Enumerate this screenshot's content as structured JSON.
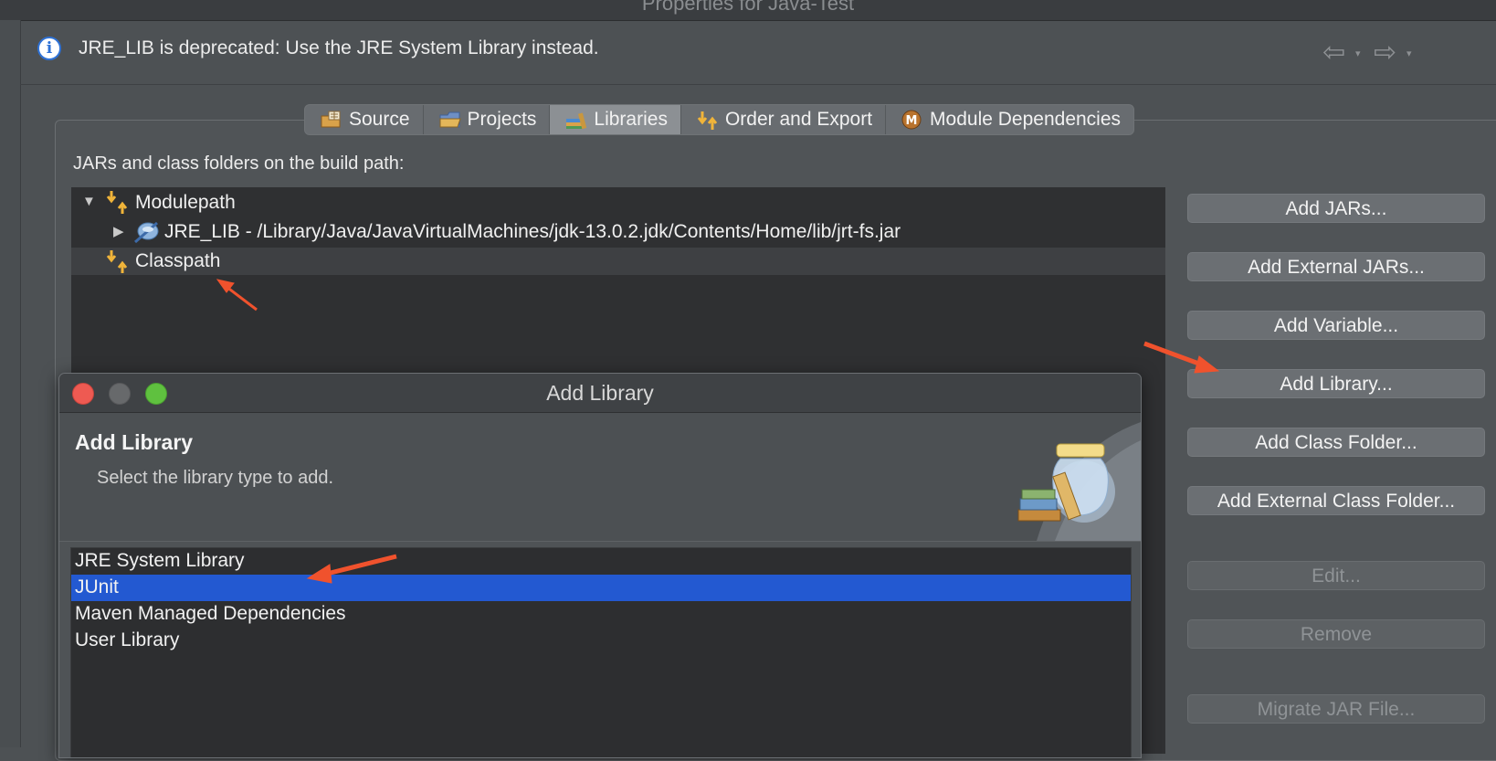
{
  "window": {
    "title": "Properties for Java-Test"
  },
  "info_bar": {
    "message": "JRE_LIB is deprecated: Use the JRE System Library instead."
  },
  "tabs": [
    {
      "label": "Source",
      "icon": "source-folder-icon",
      "active": false
    },
    {
      "label": "Projects",
      "icon": "projects-folder-icon",
      "active": false
    },
    {
      "label": "Libraries",
      "icon": "libraries-icon",
      "active": true
    },
    {
      "label": "Order and Export",
      "icon": "order-export-icon",
      "active": false
    },
    {
      "label": "Module Dependencies",
      "icon": "module-icon",
      "active": false
    }
  ],
  "build_path": {
    "label": "JARs and class folders on the build path:",
    "tree": [
      {
        "label": "Modulepath",
        "icon": "modulepath-icon",
        "expanded": true
      },
      {
        "label": "JRE_LIB - /Library/Java/JavaVirtualMachines/jdk-13.0.2.jdk/Contents/Home/lib/jrt-fs.jar",
        "icon": "jar-variable-icon",
        "expanded": false
      },
      {
        "label": "Classpath",
        "icon": "classpath-icon",
        "selected": true
      }
    ]
  },
  "side_buttons": [
    {
      "label": "Add JARs...",
      "enabled": true
    },
    {
      "label": "Add External JARs...",
      "enabled": true
    },
    {
      "label": "Add Variable...",
      "enabled": true
    },
    {
      "label": "Add Library...",
      "enabled": true
    },
    {
      "label": "Add Class Folder...",
      "enabled": true
    },
    {
      "label": "Add External Class Folder...",
      "enabled": true
    },
    {
      "label": "Edit...",
      "enabled": false
    },
    {
      "label": "Remove",
      "enabled": false
    },
    {
      "label": "Migrate JAR File...",
      "enabled": false
    }
  ],
  "dialog": {
    "title": "Add Library",
    "heading": "Add Library",
    "subtitle": "Select the library type to add.",
    "library_types": [
      {
        "label": "JRE System Library",
        "selected": false
      },
      {
        "label": "JUnit",
        "selected": true
      },
      {
        "label": "Maven Managed Dependencies",
        "selected": false
      },
      {
        "label": "User Library",
        "selected": false
      }
    ]
  },
  "colors": {
    "selection_blue": "#2359d1",
    "annotation_arrow": "#f0522d",
    "close_red": "#ee5a52",
    "minimize_gray": "#67696b",
    "zoom_green": "#5fc13f"
  }
}
